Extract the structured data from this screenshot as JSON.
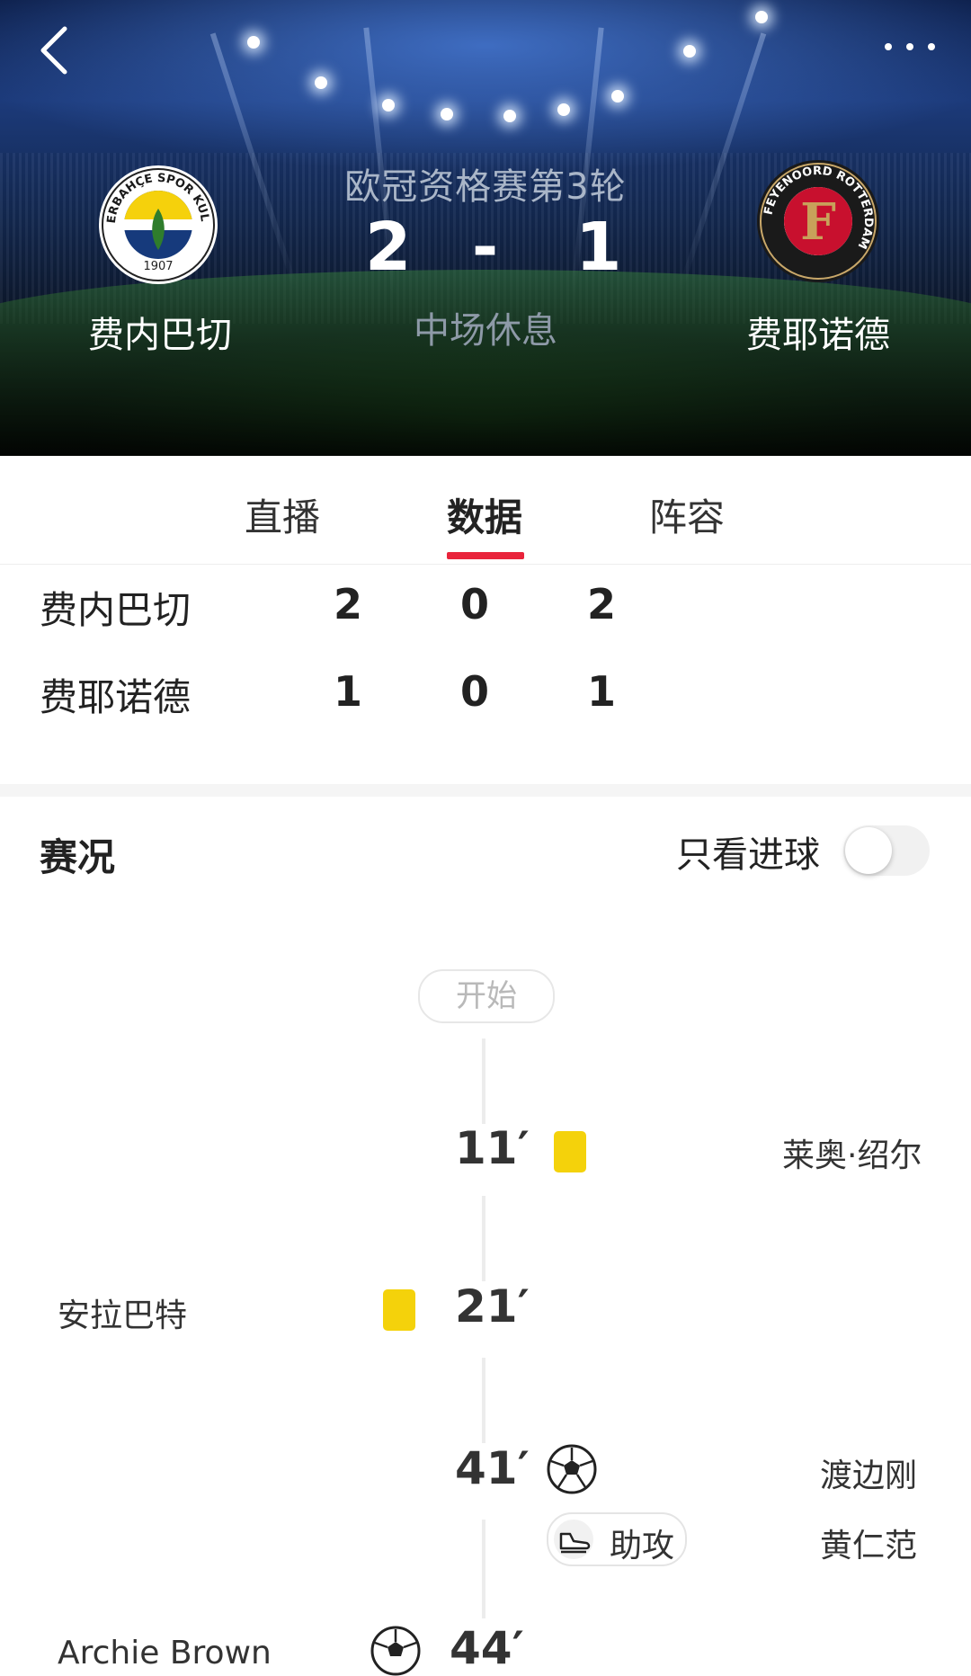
{
  "header": {
    "round": "欧冠资格赛第3轮",
    "home_team": "费内巴切",
    "away_team": "费耶诺德",
    "home_score": "2",
    "away_score": "1",
    "separator": "-",
    "status": "中场休息",
    "home_logo": {
      "ring_text": "FENERBAHÇE SPOR KULÜBÜ",
      "year": "1907"
    },
    "away_logo": {
      "ring_text": "FEYENOORD ROTTERDAM",
      "letter": "F"
    }
  },
  "tabs": [
    {
      "label": "直播"
    },
    {
      "label": "数据"
    },
    {
      "label": "阵容"
    }
  ],
  "active_tab": "数据",
  "score_table": [
    {
      "team": "费内巴切",
      "values": [
        "2",
        "0",
        "2"
      ]
    },
    {
      "team": "费耶诺德",
      "values": [
        "1",
        "0",
        "1"
      ]
    }
  ],
  "events_section": {
    "title": "赛况",
    "filter_label": "只看进球",
    "filter_on": false,
    "start_label": "开始",
    "events": [
      {
        "minute": "11′",
        "side": "away",
        "type": "yellow-card",
        "player": "莱奥·绍尔"
      },
      {
        "minute": "21′",
        "side": "home",
        "type": "yellow-card",
        "player": "安拉巴特"
      },
      {
        "minute": "41′",
        "side": "away",
        "type": "goal",
        "player": "渡边刚",
        "assist_label": "助攻",
        "assist_player": "黄仁范"
      },
      {
        "minute": "44′",
        "side": "home",
        "type": "goal",
        "player": "Archie Brown"
      }
    ]
  },
  "colors": {
    "accent": "#e9243b",
    "yellow_card": "#f4d20b",
    "fenerbahce_yellow": "#f5d10c",
    "fenerbahce_navy": "#163a7c",
    "feyenoord_red": "#c8102e"
  }
}
